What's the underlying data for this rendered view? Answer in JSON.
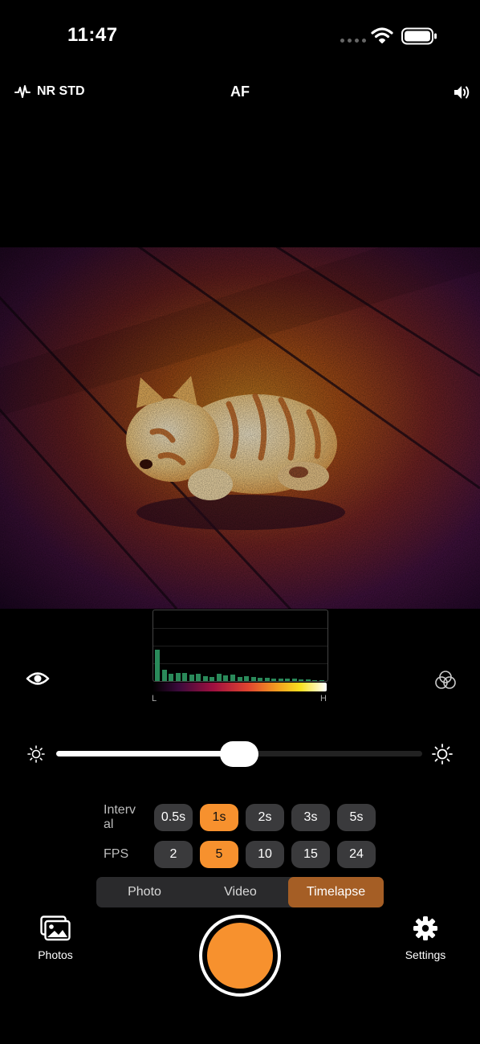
{
  "status_bar": {
    "time": "11:47"
  },
  "top_bar": {
    "noise_reduction": "NR STD",
    "focus_mode": "AF"
  },
  "histogram": {
    "low_label": "L",
    "high_label": "H",
    "levels": [
      0.45,
      0.16,
      0.1,
      0.12,
      0.12,
      0.09,
      0.11,
      0.07,
      0.06,
      0.11,
      0.08,
      0.09,
      0.06,
      0.07,
      0.06,
      0.05,
      0.05,
      0.04,
      0.04,
      0.03,
      0.03,
      0.02,
      0.02,
      0.01,
      0.01
    ]
  },
  "brightness_slider": {
    "value": 0.5
  },
  "interval": {
    "label": "Interv\nal",
    "options": [
      "0.5s",
      "1s",
      "2s",
      "3s",
      "5s"
    ],
    "selected": "1s"
  },
  "fps": {
    "label": "FPS",
    "options": [
      "2",
      "5",
      "10",
      "15",
      "24"
    ],
    "selected": "5"
  },
  "modes": {
    "photo": "Photo",
    "video": "Video",
    "timelapse": "Timelapse",
    "selected": "Timelapse"
  },
  "bottom_bar": {
    "photos_label": "Photos",
    "settings_label": "Settings"
  },
  "colors": {
    "accent": "#f7912e",
    "mode_selected": "#a55e25",
    "histogram_bars": "#2a8a5a"
  }
}
